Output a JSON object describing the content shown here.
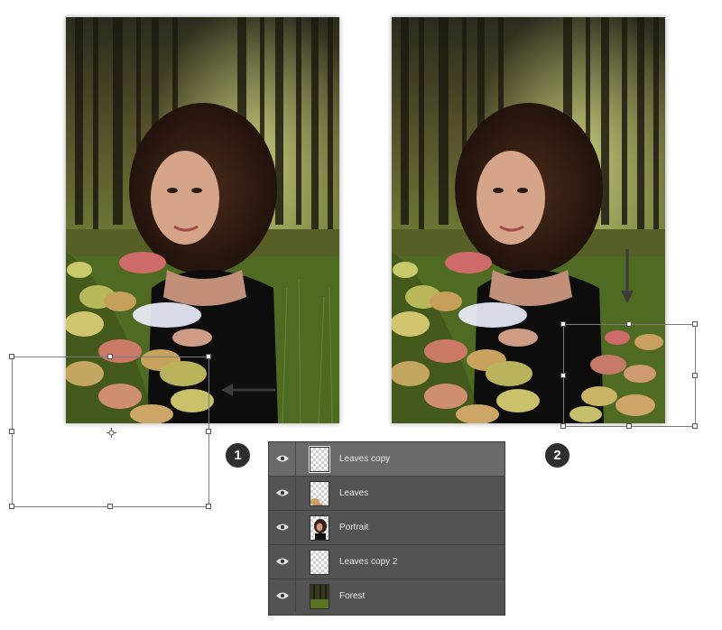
{
  "steps": [
    {
      "number": "1"
    },
    {
      "number": "2"
    }
  ],
  "layers_panel": {
    "layers": [
      {
        "name": "Leaves copy",
        "selected": true,
        "visible": true,
        "thumb": "leaves-corner-transparent"
      },
      {
        "name": "Leaves",
        "selected": false,
        "visible": true,
        "thumb": "leaves-transparent"
      },
      {
        "name": "Portrait",
        "selected": false,
        "visible": true,
        "thumb": "portrait"
      },
      {
        "name": "Leaves copy 2",
        "selected": false,
        "visible": true,
        "thumb": "empty-transparent"
      },
      {
        "name": "Forest",
        "selected": false,
        "visible": true,
        "thumb": "forest"
      }
    ]
  },
  "icons": {
    "visibility": "eye-icon",
    "move_direction_1": "arrow-left-icon",
    "move_direction_2": "arrow-down-icon",
    "transform_center": "crosshair-icon"
  },
  "colors": {
    "panel_bg": "#535353",
    "selected_row": "#6a6a6a",
    "badge": "#2e2e2e"
  }
}
